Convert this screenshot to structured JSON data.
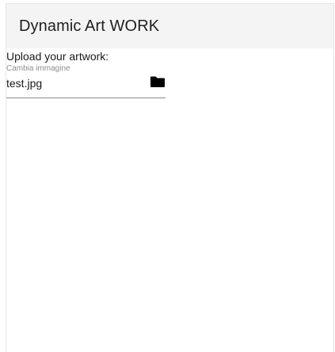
{
  "app": {
    "title": "Dynamic Art WORK"
  },
  "upload": {
    "label": "Upload your artwork:",
    "hint": "Cambia immagine",
    "file_name": "test.jpg",
    "browse_icon": "folder-icon"
  }
}
